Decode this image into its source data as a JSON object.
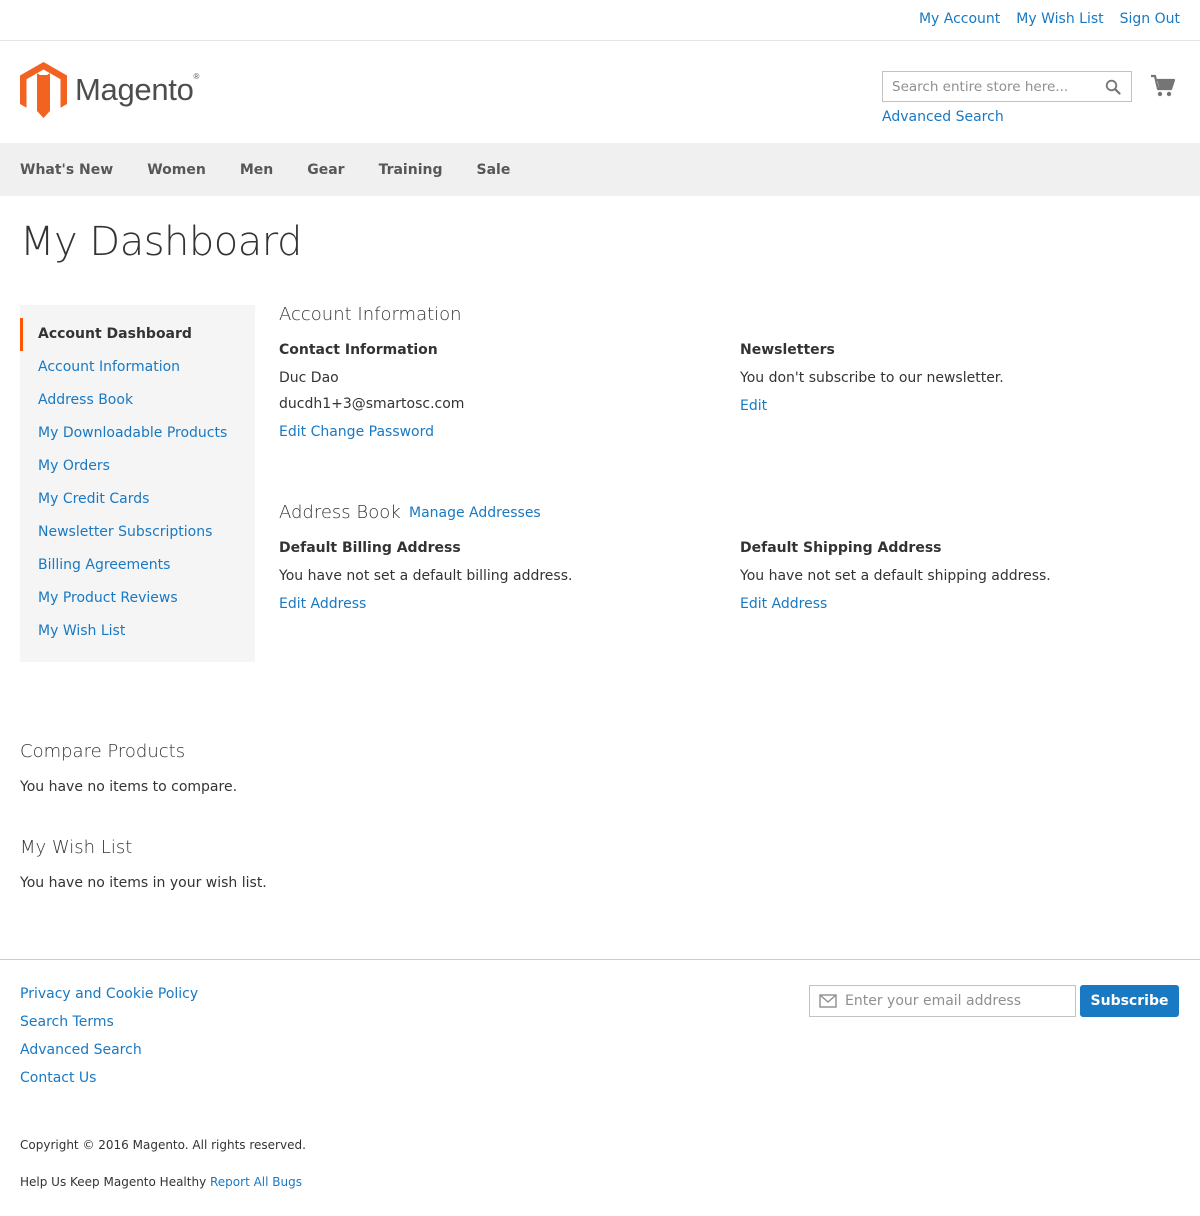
{
  "top_links": {
    "my_account": "My Account",
    "my_wish_list": "My Wish List",
    "sign_out": "Sign Out"
  },
  "header": {
    "logo_text": "Magento",
    "logo_reg": "®",
    "search_placeholder": "Search entire store here...",
    "advanced_search": "Advanced Search",
    "brand_color": "#f26322"
  },
  "nav": {
    "items": [
      "What's New",
      "Women",
      "Men",
      "Gear",
      "Training",
      "Sale"
    ]
  },
  "page": {
    "title": "My Dashboard"
  },
  "sidebar": {
    "items": [
      {
        "label": "Account Dashboard",
        "current": true
      },
      {
        "label": "Account Information"
      },
      {
        "label": "Address Book"
      },
      {
        "label": "My Downloadable Products"
      },
      {
        "label": "My Orders"
      },
      {
        "label": "My Credit Cards"
      },
      {
        "label": "Newsletter Subscriptions"
      },
      {
        "label": "Billing Agreements"
      },
      {
        "label": "My Product Reviews"
      },
      {
        "label": "My Wish List"
      }
    ],
    "accent_color": "#ff5501"
  },
  "account_info": {
    "block_title": "Account Information",
    "contact": {
      "title": "Contact Information",
      "name": "Duc Dao",
      "email": "ducdh1+3@smartosc.com",
      "edit": "Edit",
      "change_password": "Change Password"
    },
    "newsletters": {
      "title": "Newsletters",
      "status": "You don't subscribe to our newsletter.",
      "edit": "Edit"
    }
  },
  "address_book": {
    "block_title": "Address Book",
    "manage": "Manage Addresses",
    "billing": {
      "title": "Default Billing Address",
      "text": "You have not set a default billing address.",
      "edit": "Edit Address"
    },
    "shipping": {
      "title": "Default Shipping Address",
      "text": "You have not set a default shipping address.",
      "edit": "Edit Address"
    }
  },
  "compare": {
    "title": "Compare Products",
    "empty": "You have no items to compare."
  },
  "wishlist": {
    "title": "My Wish List",
    "empty": "You have no items in your wish list."
  },
  "footer": {
    "links": [
      "Privacy and Cookie Policy",
      "Search Terms",
      "Advanced Search",
      "Contact Us"
    ],
    "newsletter_placeholder": "Enter your email address",
    "subscribe": "Subscribe",
    "copyright": "Copyright © 2016 Magento. All rights reserved.",
    "bugs_text": "Help Us Keep Magento Healthy",
    "bugs_link": "Report All Bugs"
  }
}
